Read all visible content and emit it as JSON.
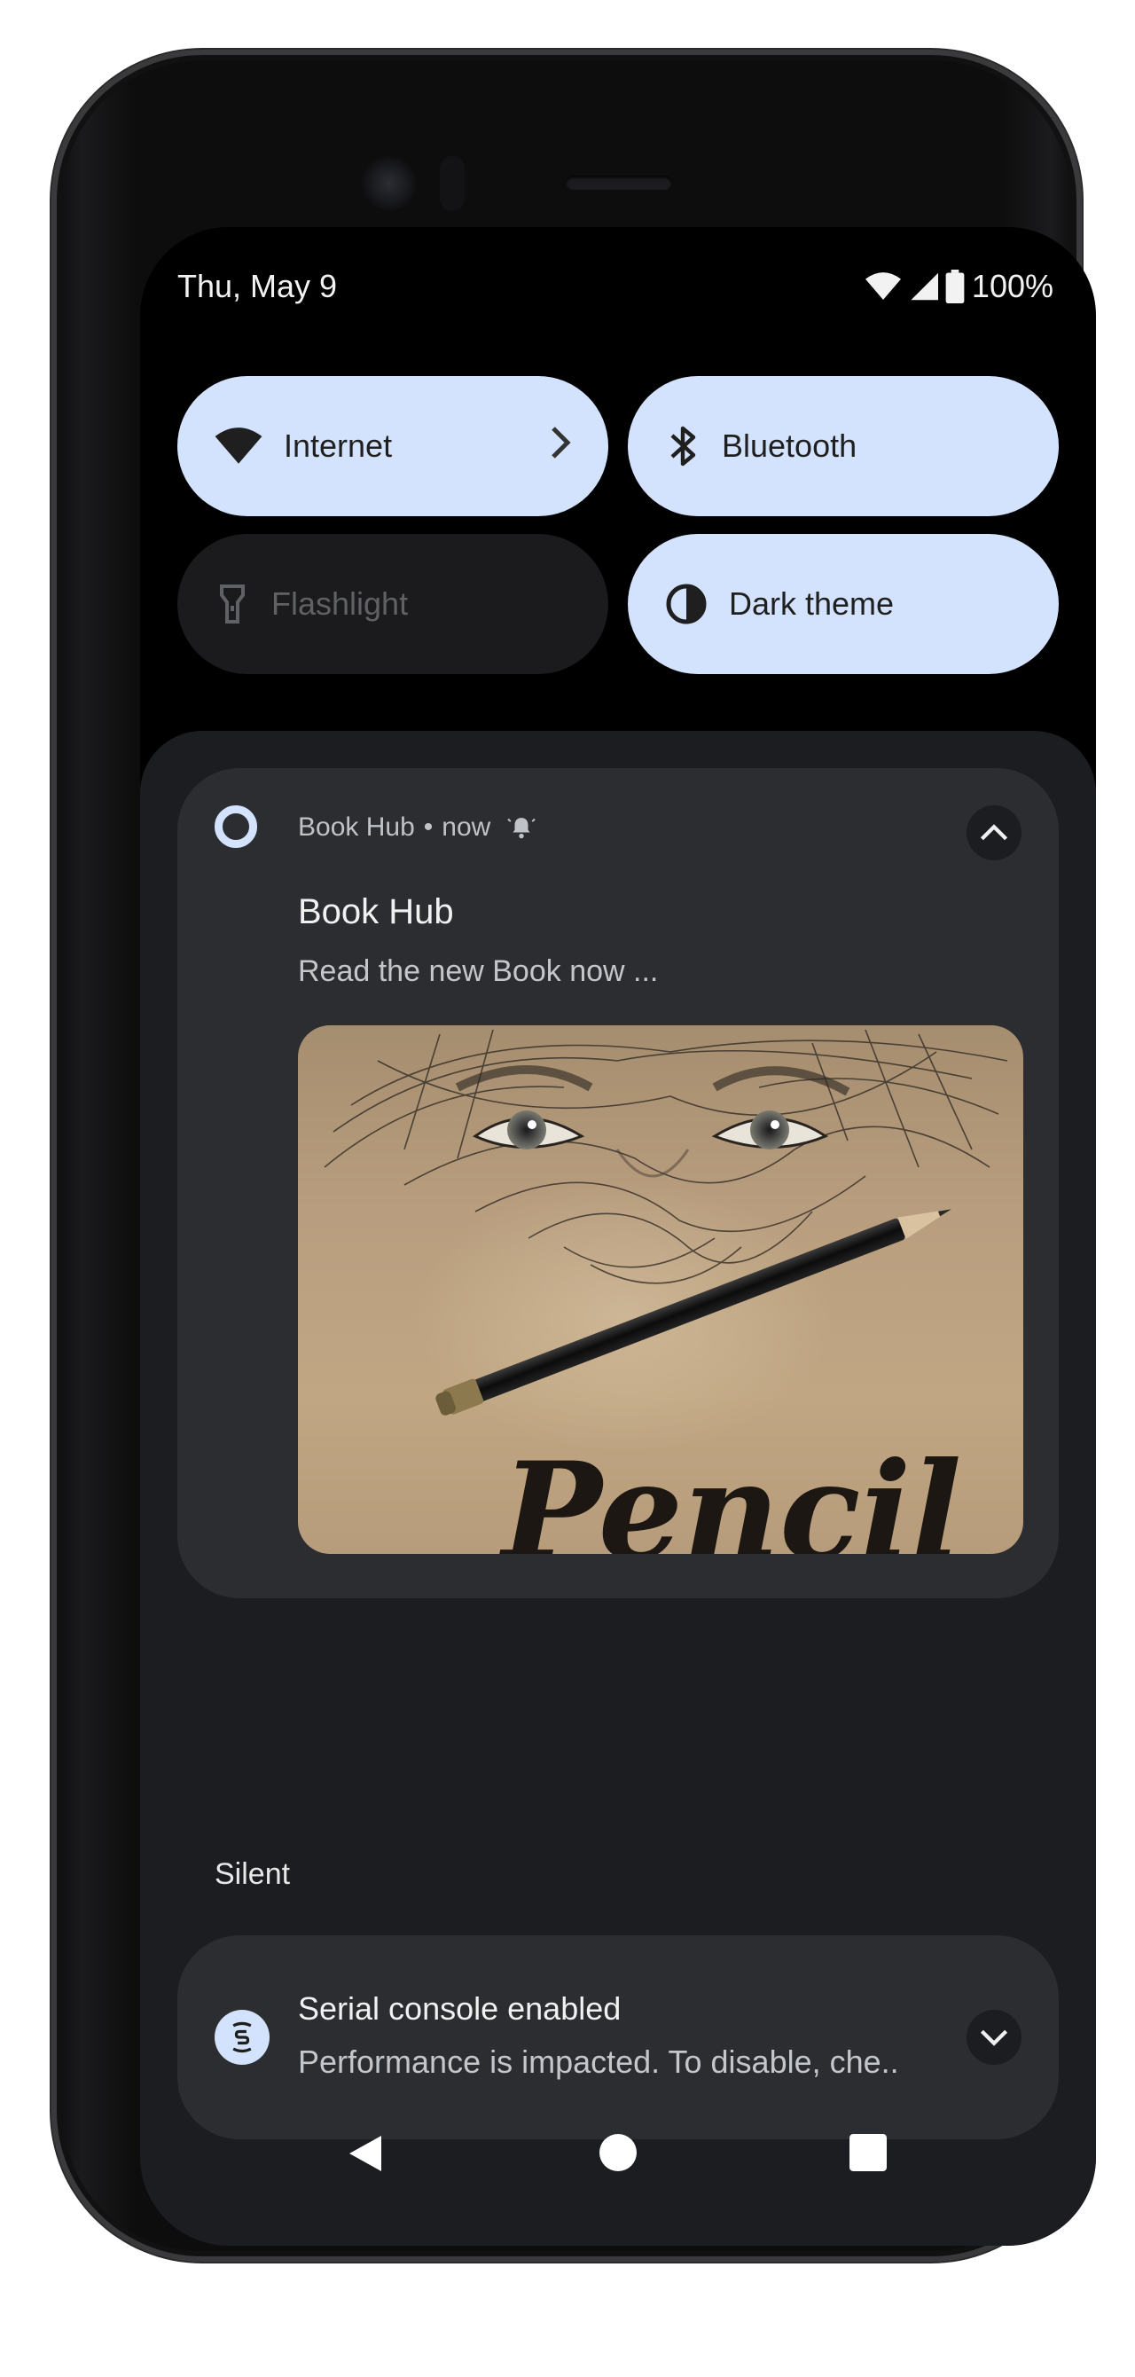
{
  "status_bar": {
    "date": "Thu, May 9",
    "battery": "100%"
  },
  "quick_settings": [
    {
      "label": "Internet",
      "state": "on",
      "icon": "wifi-icon"
    },
    {
      "label": "Bluetooth",
      "state": "on",
      "icon": "bluetooth-icon"
    },
    {
      "label": "Flashlight",
      "state": "off",
      "icon": "flashlight-icon"
    },
    {
      "label": "Dark theme",
      "state": "on",
      "icon": "dark-theme-icon"
    }
  ],
  "notification": {
    "app": "Book Hub",
    "time": "now",
    "title": "Book Hub",
    "text": "Read the new Book now ...",
    "image_text": "Pencil"
  },
  "section": {
    "silent": "Silent"
  },
  "silent_notification": {
    "title": "Serial console enabled",
    "text": "Performance is impacted. To disable, che.."
  },
  "colors": {
    "accent": "#d3e3fd",
    "shade": "#1b1d20",
    "card": "#2b2d31"
  }
}
